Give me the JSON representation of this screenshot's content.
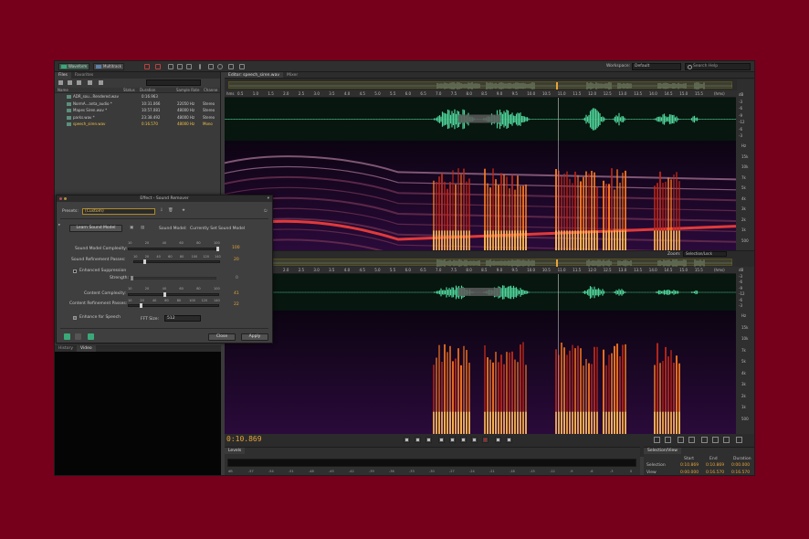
{
  "toolbar": {
    "waveform_label": "Waveform",
    "multitrack_label": "Multitrack",
    "workspace_label": "Workspace:",
    "workspace_value": "Default",
    "search_placeholder": "Search Help"
  },
  "files_panel": {
    "tabs": [
      "Files",
      "Favorites"
    ],
    "columns": [
      "Name",
      "Status",
      "Duration",
      "Sample Rate",
      "Channe"
    ],
    "rows": [
      {
        "name": "ADR_sou...Rendered.wav",
        "status": "",
        "duration": "0:16.963",
        "rate": "",
        "channels": ""
      },
      {
        "name": "NormA...anta_audio *",
        "status": "",
        "duration": "10:31.066",
        "rate": "22050 Hz",
        "channels": "Stereo"
      },
      {
        "name": "Mapes Siren.wav *",
        "status": "",
        "duration": "10:57.081",
        "rate": "48000 Hz",
        "channels": "Stereo"
      },
      {
        "name": "parks.wav *",
        "status": "",
        "duration": "23:38.492",
        "rate": "48000 Hz",
        "channels": "Stereo"
      },
      {
        "name": "speech_siren.wav",
        "status": "",
        "duration": "0:16.570",
        "rate": "48000 Hz",
        "channels": "Mono"
      }
    ]
  },
  "lower_tabs": [
    "History",
    "Video"
  ],
  "editor": {
    "tab_label": "Editor: speech_siren.wav",
    "mixer_label": "Mixer",
    "ruler_unit": "hms",
    "ruler_ticks": [
      "0.5",
      "1.0",
      "1.5",
      "2.0",
      "2.5",
      "3.0",
      "3.5",
      "4.0",
      "4.5",
      "5.0",
      "5.5",
      "6.0",
      "6.5",
      "7.0",
      "7.5",
      "8.0",
      "8.5",
      "9.0",
      "9.5",
      "10.0",
      "10.5",
      "11.0",
      "11.5",
      "12.0",
      "12.5",
      "13.0",
      "13.5",
      "14.0",
      "14.5",
      "15.0",
      "15.5"
    ],
    "ruler_end": "(hms)",
    "db_labels": [
      "dB",
      "-3",
      "-6",
      "-9",
      "-12",
      "-6",
      "-3"
    ],
    "hz_labels": [
      "Hz",
      "15k",
      "10k",
      "7k",
      "5k",
      "4k",
      "3k",
      "2k",
      "1k",
      "500"
    ],
    "zoom_label": "Zoom:",
    "zoom_value": "Selection/Lock",
    "second_ruler_ticks": [
      "2.0",
      "2.5",
      "3.0",
      "3.5",
      "4.0",
      "4.5",
      "5.0",
      "5.5",
      "6.0",
      "6.5",
      "7.0",
      "7.5",
      "8.0",
      "8.5",
      "9.0",
      "9.5",
      "10.0",
      "10.5",
      "11.0",
      "11.5",
      "12.0",
      "12.5",
      "13.0",
      "13.5",
      "14.0",
      "14.5",
      "15.0",
      "15.5"
    ],
    "second_ruler_label": "nered",
    "playhead_fraction": 0.653
  },
  "transport": {
    "timecode": "0:10.869"
  },
  "levels": {
    "tab": "Levels",
    "ticks": [
      "dB",
      "-57",
      "-54",
      "-51",
      "-48",
      "-45",
      "-42",
      "-39",
      "-36",
      "-33",
      "-30",
      "-27",
      "-24",
      "-21",
      "-18",
      "-15",
      "-12",
      "-9",
      "-6",
      "-3",
      "0"
    ]
  },
  "selection_view": {
    "tab": "Selection/View",
    "headers": [
      "Start",
      "End",
      "Duration"
    ],
    "rows": [
      {
        "label": "Selection",
        "start": "0:10.869",
        "end": "0:10.869",
        "duration": "0:00.000"
      },
      {
        "label": "View",
        "start": "0:00.000",
        "end": "0:16.570",
        "duration": "0:16.570"
      }
    ]
  },
  "dialog": {
    "title": "Effect - Sound Remover",
    "presets_label": "Presets:",
    "presets_value": "(Custom)",
    "learn_button": "Learn Sound Model",
    "sound_model_label": "Sound Model:",
    "sound_model_value": "Currently Set Sound Model",
    "complexity_label": "Sound Model Complexity:",
    "complexity_scale": [
      "10",
      "20",
      "40",
      "60",
      "80",
      "100"
    ],
    "complexity_value": "100",
    "refinement_label": "Sound Refinement Passes:",
    "refinement_scale": [
      "10",
      "20",
      "40",
      "60",
      "80",
      "100",
      "120",
      "140"
    ],
    "refinement_value": "20",
    "enhanced_label": "Enhanced Suppression",
    "strength_label": "Strength:",
    "strength_value": "0",
    "content_complexity_label": "Content Complexity:",
    "content_complexity_scale": [
      "10",
      "20",
      "40",
      "60",
      "80",
      "100"
    ],
    "content_complexity_value": "41",
    "content_refinement_label": "Content Refinement Passes:",
    "content_refinement_scale": [
      "10",
      "20",
      "40",
      "60",
      "80",
      "100",
      "120",
      "140"
    ],
    "content_refinement_value": "22",
    "enhance_speech_label": "Enhance for Speech",
    "fft_label": "FFT Size:",
    "fft_value": "512",
    "close_button": "Close",
    "apply_button": "Apply"
  },
  "colors": {
    "background": "#76001c",
    "waveform": "#4fd49a",
    "accent": "#e8a43a"
  }
}
